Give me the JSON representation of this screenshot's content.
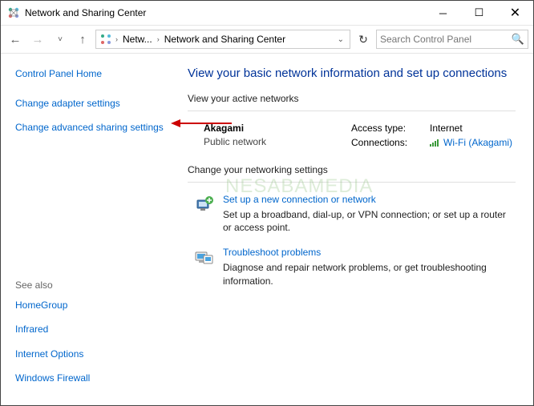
{
  "window": {
    "title": "Network and Sharing Center"
  },
  "nav": {
    "breadcrumb1": "Netw...",
    "breadcrumb2": "Network and Sharing Center",
    "search_placeholder": "Search Control Panel"
  },
  "sidebar": {
    "home": "Control Panel Home",
    "links": [
      "Change adapter settings",
      "Change advanced sharing settings"
    ],
    "see_also_label": "See also",
    "see_also": [
      "HomeGroup",
      "Infrared",
      "Internet Options",
      "Windows Firewall"
    ]
  },
  "content": {
    "heading": "View your basic network information and set up connections",
    "active_label": "View your active networks",
    "network": {
      "name": "Akagami",
      "type": "Public network",
      "access_key": "Access type:",
      "access_val": "Internet",
      "conn_key": "Connections:",
      "conn_val": "Wi-Fi (Akagami)"
    },
    "settings_label": "Change your networking settings",
    "setup": {
      "title": "Set up a new connection or network",
      "desc": "Set up a broadband, dial-up, or VPN connection; or set up a router or access point."
    },
    "troubleshoot": {
      "title": "Troubleshoot problems",
      "desc": "Diagnose and repair network problems, or get troubleshooting information."
    }
  },
  "watermark": "NESABAMEDIA"
}
